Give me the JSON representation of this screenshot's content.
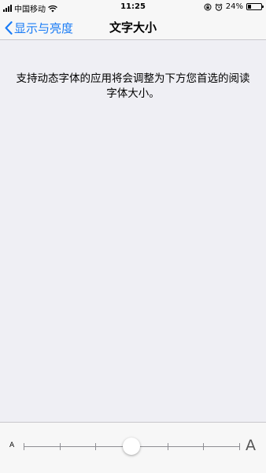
{
  "status_bar": {
    "carrier": "中国移动",
    "time": "11:25",
    "battery_percent": "24%",
    "battery_level": 0.24,
    "icons": [
      "signal-bars-icon",
      "wifi-icon",
      "orientation-lock-icon",
      "alarm-icon",
      "battery-icon"
    ]
  },
  "nav": {
    "back_label": "显示与亮度",
    "title": "文字大小"
  },
  "content": {
    "description": "支持动态字体的应用将会调整为下方您首选的阅读字体大小。"
  },
  "slider": {
    "small_label": "A",
    "large_label": "A",
    "steps": 7,
    "value_index": 3
  },
  "colors": {
    "accent": "#1a7cf6",
    "background": "#efeff4",
    "bar_background": "#f7f7f7"
  }
}
